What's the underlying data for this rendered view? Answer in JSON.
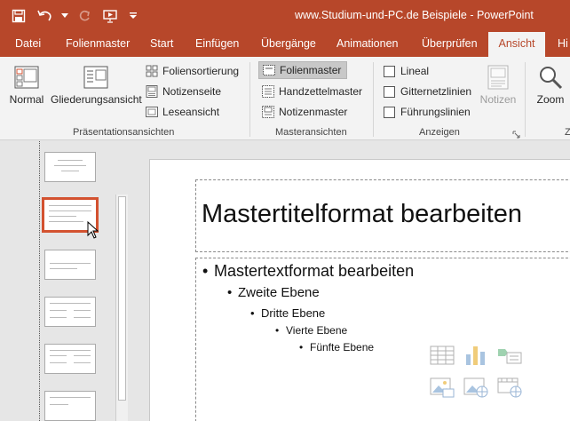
{
  "window": {
    "title": "www.Studium-und-PC.de  Beispiele  -  PowerPoint"
  },
  "qat": [
    "save-icon",
    "undo-icon",
    "redo-icon",
    "start-presentation-icon",
    "customize-qat-icon"
  ],
  "tabs": [
    "Datei",
    "Folienmaster",
    "Start",
    "Einfügen",
    "Übergänge",
    "Animationen",
    "Überprüfen",
    "Ansicht",
    "Hi"
  ],
  "active_tab": "Ansicht",
  "ribbon": {
    "presentation_views": {
      "label": "Präsentationsansichten",
      "normal": "Normal",
      "outline": "Gliederungsansicht",
      "slide_sorter": "Foliensortierung",
      "notes_page": "Notizenseite",
      "reading_view": "Leseansicht"
    },
    "master_views": {
      "label": "Masteransichten",
      "slide_master": "Folienmaster",
      "handout_master": "Handzettelmaster",
      "notes_master": "Notizenmaster"
    },
    "show": {
      "label": "Anzeigen",
      "ruler": "Lineal",
      "gridlines": "Gitternetzlinien",
      "guides": "Führungslinien",
      "notes": "Notizen"
    },
    "zoom": {
      "label": "Zoom",
      "group_label_partial": "Z"
    }
  },
  "slide": {
    "title": "Mastertitelformat bearbeiten",
    "levels": [
      "Mastertextformat bearbeiten",
      "Zweite Ebene",
      "Dritte Ebene",
      "Vierte Ebene",
      "Fünfte Ebene"
    ]
  },
  "colors": {
    "accent": "#b7472a",
    "selection": "#d35230"
  }
}
